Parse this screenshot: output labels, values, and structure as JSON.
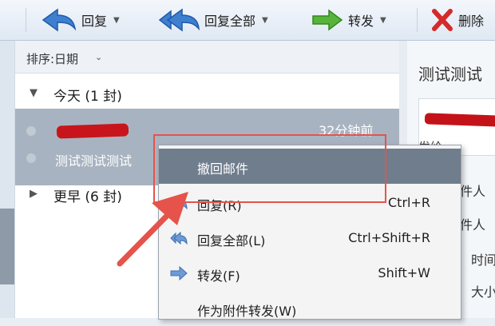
{
  "toolbar": {
    "reply_label": "回复",
    "reply_all_label": "回复全部",
    "forward_label": "转发",
    "delete_label": "删除"
  },
  "mail_list": {
    "sort_label": "排序:日期",
    "groups": [
      {
        "label": "今天 (1 封)"
      },
      {
        "label": "更早 (6 封)"
      }
    ],
    "selected_mail": {
      "time": "32分钟前",
      "subject": "测试测试测试"
    }
  },
  "reading_pane": {
    "title": "测试测试",
    "sent_prefix": "发给",
    "attach_lines": [
      "发件人",
      "收件人",
      "时间",
      "大小"
    ]
  },
  "context_menu": {
    "items": [
      {
        "label": "撤回邮件",
        "shortcut": ""
      },
      {
        "label": "回复(R)",
        "shortcut": "Ctrl+R"
      },
      {
        "label": "回复全部(L)",
        "shortcut": "Ctrl+Shift+R"
      },
      {
        "label": "转发(F)",
        "shortcut": "Shift+W"
      },
      {
        "label": "作为附件转发(W)",
        "shortcut": ""
      }
    ]
  },
  "colors": {
    "highlight_box": "#e5534b",
    "menu_highlight": "#6f7d8d",
    "selection": "#a8b3c1",
    "redaction": "#c8151b"
  }
}
